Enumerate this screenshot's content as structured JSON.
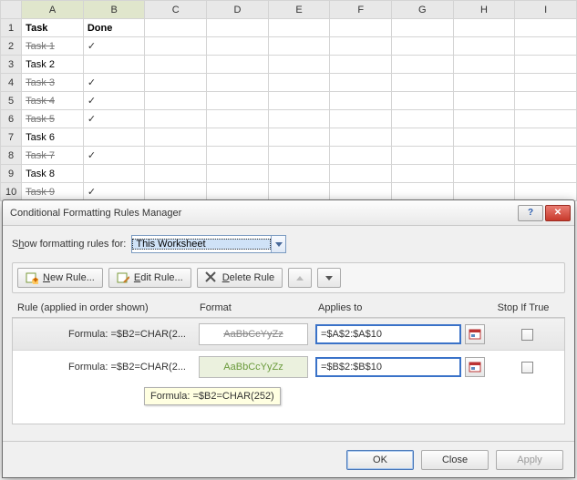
{
  "columns": [
    "A",
    "B",
    "C",
    "D",
    "E",
    "F",
    "G",
    "H",
    "I"
  ],
  "rows": [
    "1",
    "2",
    "3",
    "4",
    "5",
    "6",
    "7",
    "8",
    "9",
    "10"
  ],
  "headerA": "Task",
  "headerB": "Done",
  "tasks": [
    {
      "name": "Task 1",
      "done": true
    },
    {
      "name": "Task 2",
      "done": false
    },
    {
      "name": "Task 3",
      "done": true
    },
    {
      "name": "Task 4",
      "done": true
    },
    {
      "name": "Task 5",
      "done": true
    },
    {
      "name": "Task 6",
      "done": false
    },
    {
      "name": "Task 7",
      "done": true
    },
    {
      "name": "Task 8",
      "done": false
    },
    {
      "name": "Task 9",
      "done": true
    }
  ],
  "checkmark": "✓",
  "dialog": {
    "title": "Conditional Formatting Rules Manager",
    "show_label_pre": "S",
    "show_label_u": "h",
    "show_label_post": "ow formatting rules for:",
    "scope": "This Worksheet",
    "new_rule_u": "N",
    "new_rule": "ew Rule...",
    "edit_rule_u": "E",
    "edit_rule": "dit Rule...",
    "delete_rule_u": "D",
    "delete_rule": "elete Rule",
    "col_rule": "Rule (applied in order shown)",
    "col_format": "Format",
    "col_applies": "Applies to",
    "col_stop": "Stop If True",
    "rules": [
      {
        "formula": "Formula: =$B2=CHAR(2...",
        "preview": "AaBbCcYyZz",
        "applies": "=$A$2:$A$10",
        "style": "strike"
      },
      {
        "formula": "Formula: =$B2=CHAR(2...",
        "preview": "AaBbCcYyZz",
        "applies": "=$B$2:$B$10",
        "style": "green"
      }
    ],
    "tooltip": "Formula: =$B2=CHAR(252)",
    "ok": "OK",
    "close": "Close",
    "apply": "Apply"
  }
}
